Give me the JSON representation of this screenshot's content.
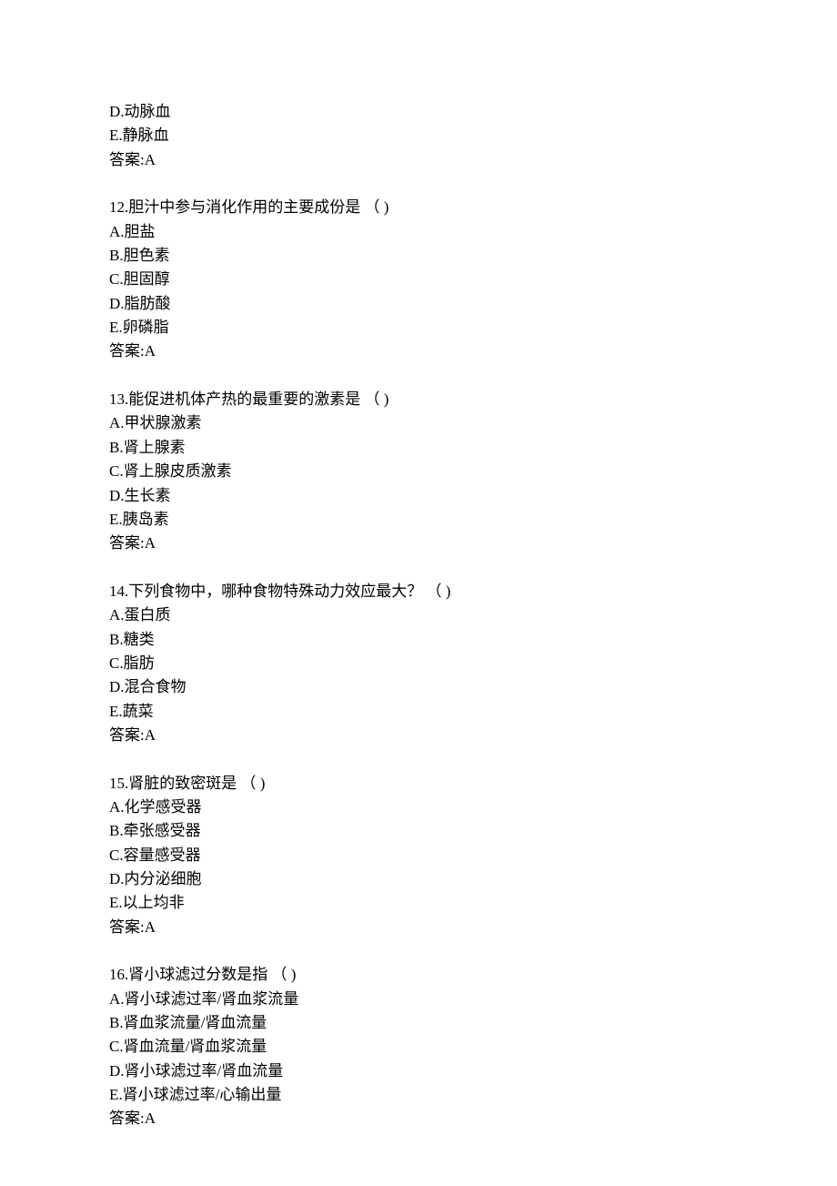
{
  "lines": [
    "D.动脉血",
    "E.静脉血",
    "答案:A",
    "",
    "12.胆汁中参与消化作用的主要成份是 （ )",
    "A.胆盐",
    "B.胆色素",
    "C.胆固醇",
    "D.脂肪酸",
    "E.卵磷脂",
    "答案:A",
    "",
    "13.能促进机体产热的最重要的激素是 （ )",
    "A.甲状腺激素",
    "B.肾上腺素",
    "C.肾上腺皮质激素",
    "D.生长素",
    "E.胰岛素",
    "答案:A",
    "",
    "14.下列食物中，哪种食物特殊动力效应最大？ （ )",
    "A.蛋白质",
    "B.糖类",
    "C.脂肪",
    "D.混合食物",
    "E.蔬菜",
    "答案:A",
    "",
    "15.肾脏的致密斑是 （ )",
    "A.化学感受器",
    "B.牵张感受器",
    "C.容量感受器",
    "D.内分泌细胞",
    "E.以上均非",
    "答案:A",
    "",
    "16.肾小球滤过分数是指 （ )",
    "A.肾小球滤过率/肾血浆流量",
    "B.肾血浆流量/肾血流量",
    "C.肾血流量/肾血浆流量",
    "D.肾小球滤过率/肾血流量",
    "E.肾小球滤过率/心输出量",
    "答案:A"
  ]
}
